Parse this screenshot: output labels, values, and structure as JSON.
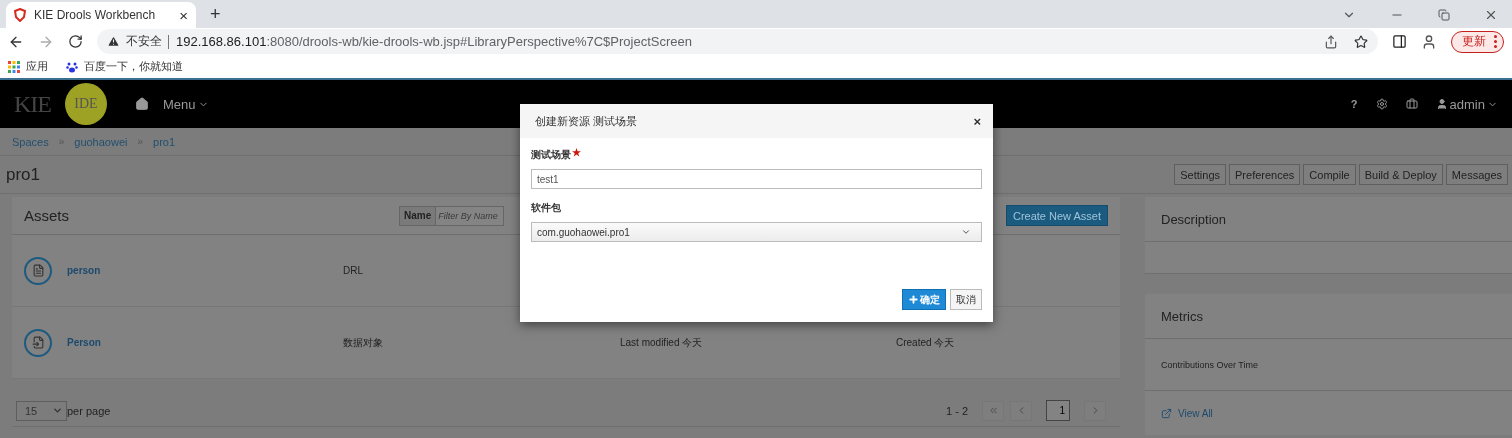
{
  "browser": {
    "tab": {
      "title": "KIE Drools Workbench",
      "close": "×",
      "new_tab": "+"
    },
    "address": {
      "security": "不安全",
      "host": "192.168.86.101",
      "path": ":8080/drools-wb/kie-drools-wb.jsp#LibraryPerspective%7C$ProjectScreen",
      "update": "更新"
    },
    "bookmarks": [
      {
        "label": "应用",
        "kind": "apps"
      },
      {
        "label": "百度一下，你就知道",
        "kind": "paw"
      }
    ]
  },
  "navbar": {
    "logo": "KIE",
    "logo_badge": "IDE",
    "menu": "Menu",
    "help": "?",
    "user": "admin"
  },
  "breadcrumbs": [
    {
      "label": "Spaces"
    },
    {
      "separator": "»",
      "label": "guohaowei"
    },
    {
      "separator": "»",
      "label": "pro1"
    }
  ],
  "project": {
    "title": "pro1",
    "actions": [
      "Settings",
      "Preferences",
      "Compile",
      "Build & Deploy",
      "Messages"
    ]
  },
  "assets": {
    "title": "Assets",
    "filter_label": "Name",
    "filter_placeholder": "Filter By Name",
    "create": "Create New Asset",
    "rows": [
      {
        "name": "person",
        "type": "DRL",
        "kind": "rule"
      },
      {
        "name": "Person",
        "type": "数据对象",
        "modified": "Last modified 今天",
        "created": "Created 今天",
        "kind": "data"
      }
    ],
    "per_page": "15",
    "per_page_label": "per page",
    "range": "1 - 2",
    "page": "1"
  },
  "side": {
    "description": "Description",
    "metrics": "Metrics",
    "contributions": "Contributions Over Time",
    "view_all": "View All"
  },
  "dialog": {
    "title": "创建新资源 测试场景",
    "close": "×",
    "fields": [
      {
        "label": "测试场景",
        "required": true,
        "kind": "text",
        "value": "test1"
      },
      {
        "label": "软件包",
        "required": false,
        "kind": "select",
        "value": "com.guohaowei.pro1"
      }
    ],
    "ok": "确定",
    "cancel": "取消"
  }
}
